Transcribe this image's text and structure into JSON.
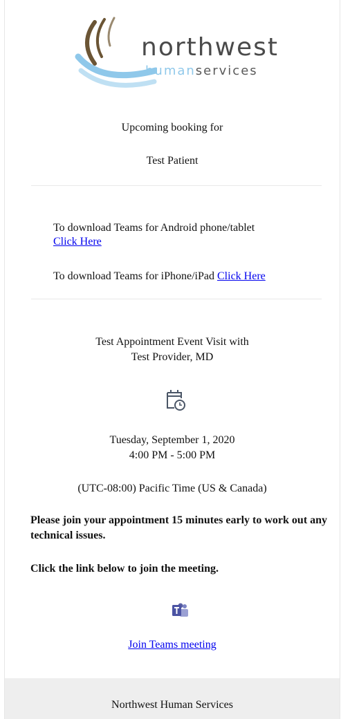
{
  "logo": {
    "word": "northwest",
    "sub_a": "human",
    "sub_b": "services"
  },
  "header": {
    "line1": "Upcoming booking for",
    "patient": "Test Patient"
  },
  "downloads": {
    "android_text": "To download Teams for Android phone/tablet",
    "android_link": "Click Here",
    "iphone_text": "To download Teams for iPhone/iPad",
    "iphone_link": "Click Here"
  },
  "appointment": {
    "title_line1": "Test Appointment Event Visit with",
    "title_line2": "Test Provider, MD",
    "date": "Tuesday, September 1, 2020",
    "time": "4:00 PM - 5:00 PM",
    "timezone": "(UTC-08:00) Pacific Time (US & Canada)",
    "calendar_icon": "calendar-clock-icon"
  },
  "notices": {
    "early": "Please join your appointment 15 minutes early to work out any technical issues.",
    "click": "Click the link below to join the meeting."
  },
  "meeting": {
    "teams_icon": "teams-icon",
    "join_link": "Join Teams meeting"
  },
  "footer": {
    "org": "Northwest Human Services"
  },
  "colors": {
    "link": "#0000ee",
    "footer_bg": "#eeeeee",
    "logo_blue": "#8fc8ea",
    "logo_brown": "#6b5535"
  }
}
